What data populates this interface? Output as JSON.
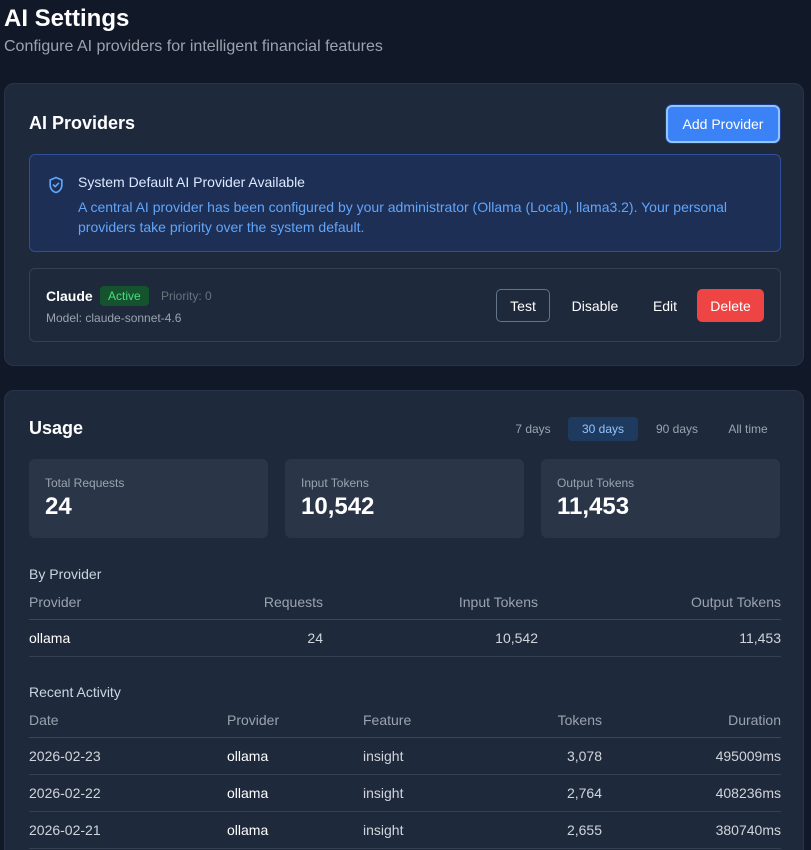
{
  "page": {
    "title": "AI Settings",
    "subtitle": "Configure AI providers for intelligent financial features"
  },
  "providers_section": {
    "title": "AI Providers",
    "add_button": "Add Provider",
    "notice": {
      "icon": "shield-check-icon",
      "title": "System Default AI Provider Available",
      "body": "A central AI provider has been configured by your administrator (Ollama (Local), llama3.2). Your personal providers take priority over the system default."
    },
    "providers": [
      {
        "name": "Claude",
        "status": "Active",
        "priority": "Priority: 0",
        "model": "Model: claude-sonnet-4.6",
        "actions": {
          "test": "Test",
          "disable": "Disable",
          "edit": "Edit",
          "delete": "Delete"
        }
      }
    ]
  },
  "usage": {
    "title": "Usage",
    "ranges": [
      "7 days",
      "30 days",
      "90 days",
      "All time"
    ],
    "selected_range": "30 days",
    "stats": [
      {
        "label": "Total Requests",
        "value": "24"
      },
      {
        "label": "Input Tokens",
        "value": "10,542"
      },
      {
        "label": "Output Tokens",
        "value": "11,453"
      }
    ],
    "by_provider": {
      "title": "By Provider",
      "columns": [
        "Provider",
        "Requests",
        "Input Tokens",
        "Output Tokens"
      ],
      "rows": [
        {
          "provider": "ollama",
          "requests": "24",
          "input_tokens": "10,542",
          "output_tokens": "11,453"
        }
      ]
    },
    "recent_activity": {
      "title": "Recent Activity",
      "columns": [
        "Date",
        "Provider",
        "Feature",
        "Tokens",
        "Duration"
      ],
      "rows": [
        {
          "date": "2026-02-23",
          "provider": "ollama",
          "feature": "insight",
          "tokens": "3,078",
          "duration": "495009ms"
        },
        {
          "date": "2026-02-22",
          "provider": "ollama",
          "feature": "insight",
          "tokens": "2,764",
          "duration": "408236ms"
        },
        {
          "date": "2026-02-21",
          "provider": "ollama",
          "feature": "insight",
          "tokens": "2,655",
          "duration": "380740ms"
        }
      ]
    }
  },
  "colors": {
    "background": "#111827",
    "card": "#1e293b",
    "accent": "#3b82f6",
    "danger": "#ef4444",
    "success": "#4ade80"
  }
}
